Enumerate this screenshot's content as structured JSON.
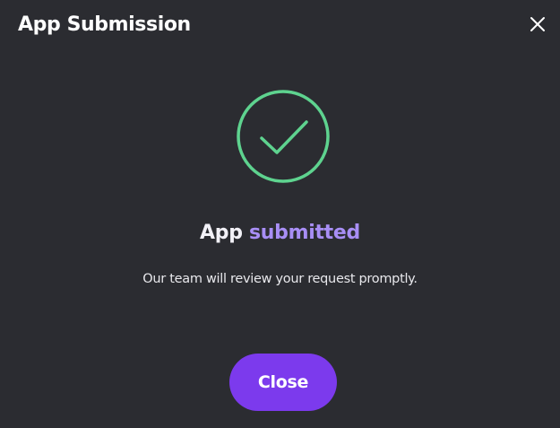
{
  "dialog": {
    "title": "App Submission",
    "close_icon": "close-icon"
  },
  "status": {
    "icon": "check-circle-icon",
    "icon_color": "#5ed38f",
    "headline_part1": "App",
    "headline_part2": "submitted",
    "headline_accent_color": "#a88ef5",
    "message": "Our team will review your request promptly."
  },
  "footer": {
    "close_label": "Close",
    "button_color": "#7c3aed"
  }
}
